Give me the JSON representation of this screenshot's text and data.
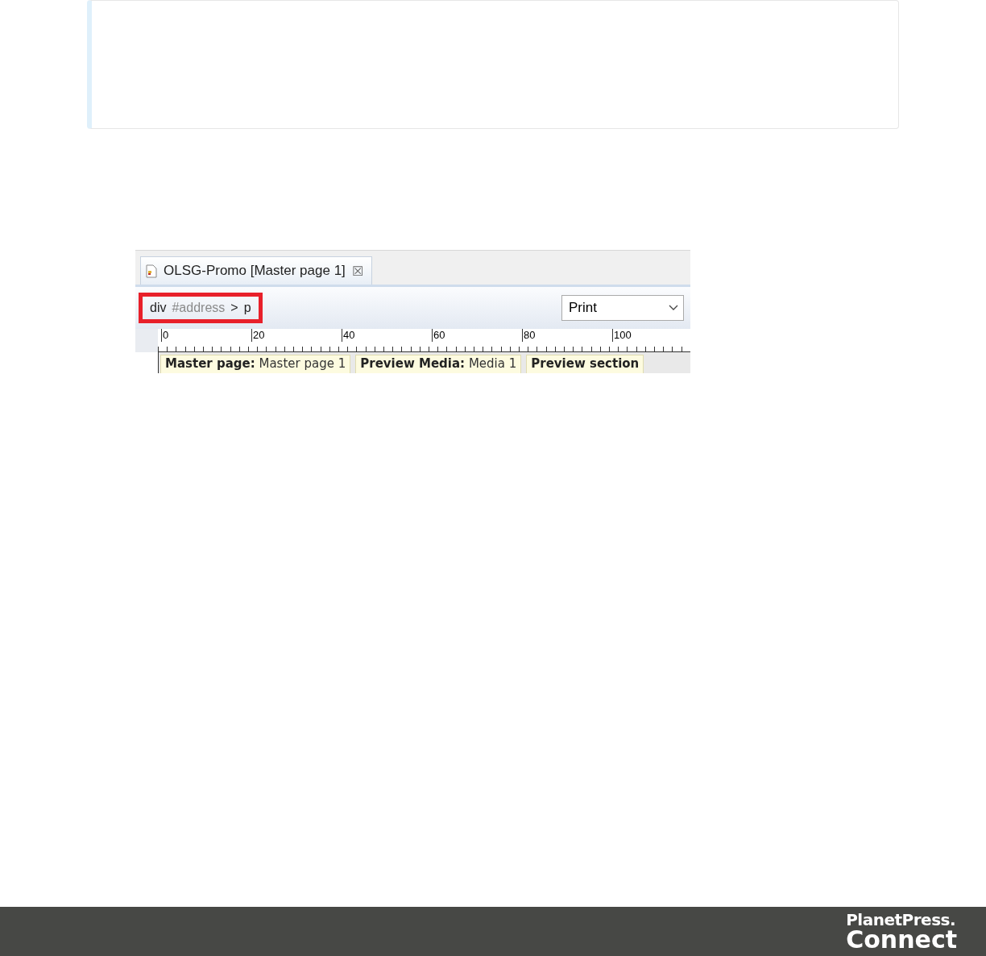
{
  "screenshot": {
    "tab": {
      "title": "OLSG-Promo [Master page 1]",
      "close": "☒"
    },
    "breadcrumb": {
      "highlighted": true,
      "segments": [
        {
          "text": "div",
          "muted": false
        },
        {
          "text": "#address",
          "muted": true
        },
        {
          "text": ">",
          "muted": false
        },
        {
          "text": "p",
          "muted": false
        }
      ]
    },
    "media_dropdown": {
      "value": "Print"
    },
    "ruler": [
      "0",
      "20",
      "40",
      "60",
      "80",
      "100"
    ],
    "info_labels": [
      {
        "label": "Master page:",
        "value": "Master page 1"
      },
      {
        "label": "Preview Media:",
        "value": "Media 1"
      },
      {
        "label": "Preview section"
      }
    ]
  },
  "footer": {
    "logo_line_1": "PlanetPress.",
    "logo_line_2": "Connect"
  }
}
